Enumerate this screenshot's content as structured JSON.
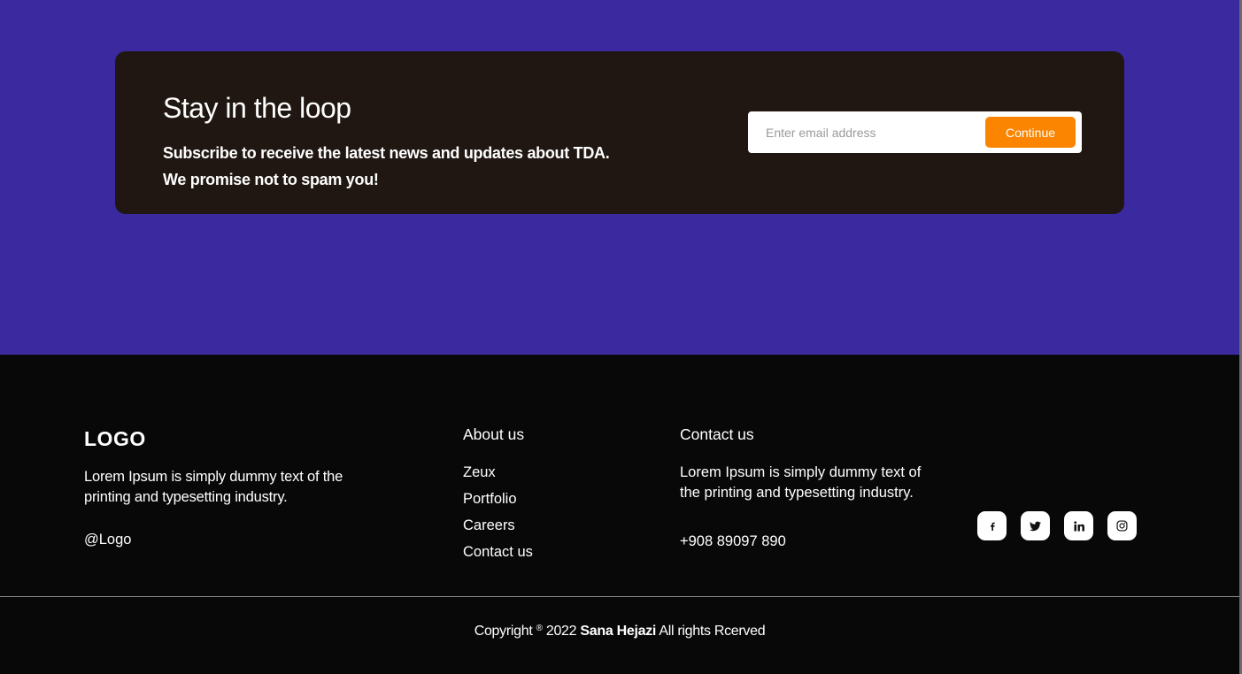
{
  "newsletter": {
    "title": "Stay in the loop",
    "subtitle_line1": "Subscribe to receive the latest news and updates about TDA.",
    "subtitle_line2": "We promise not to spam you!",
    "email_placeholder": "Enter email address",
    "email_value": "",
    "button_label": "Continue"
  },
  "footer": {
    "logo": "LOGO",
    "description": "Lorem Ipsum is simply dummy text of the printing and typesetting industry.",
    "handle": "@Logo",
    "about": {
      "title": "About us",
      "links": [
        "Zeux",
        "Portfolio",
        "Careers",
        "Contact us"
      ]
    },
    "contact": {
      "title": "Contact us",
      "description": "Lorem Ipsum is simply dummy text of the printing and typesetting industry.",
      "phone": "+908 89097 890"
    },
    "socials": [
      {
        "icon": "facebook-icon"
      },
      {
        "icon": "twitter-icon"
      },
      {
        "icon": "linkedin-icon"
      },
      {
        "icon": "instagram-icon"
      }
    ],
    "copyright": {
      "prefix": "Copyright",
      "symbol": "®",
      "year": "2022",
      "name": "Sana Hejazi",
      "suffix": "All rights Rcerved"
    }
  },
  "colors": {
    "band": "#3b29a0",
    "card": "#201712",
    "accent": "#fb8500",
    "footer_bg": "#080808"
  }
}
